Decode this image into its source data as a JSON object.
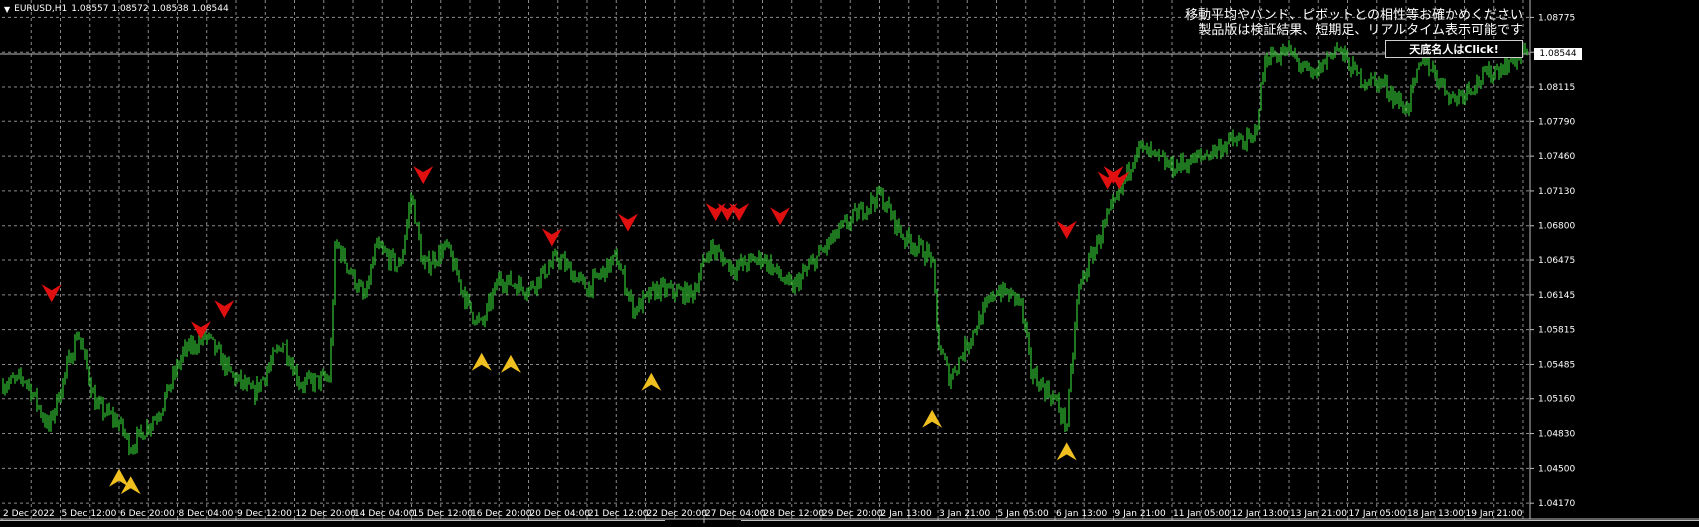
{
  "header": {
    "symbol": "EURUSD,H1",
    "ohlc": "1.08557 1.08572 1.08538 1.08544",
    "expand_icon": "triangle-down-icon"
  },
  "notice": {
    "line1": "移動平均やバンド、ピボットとの相性等お確かめください",
    "line2": "製品版は検証結果、短期足、リアルタイム表示可能です"
  },
  "promo_button": {
    "label": "天底名人はClick!"
  },
  "price_axis": {
    "current_price": "1.08544",
    "labels": [
      "1.08775",
      "1.08445",
      "1.08115",
      "1.07790",
      "1.07460",
      "1.07130",
      "1.06800",
      "1.06475",
      "1.06145",
      "1.05815",
      "1.05485",
      "1.05160",
      "1.04830",
      "1.04500",
      "1.04170"
    ]
  },
  "time_axis": {
    "labels": [
      "2 Dec 2022",
      "5 Dec 12:00",
      "6 Dec 20:00",
      "8 Dec 04:00",
      "9 Dec 12:00",
      "12 Dec 20:00",
      "14 Dec 04:00",
      "15 Dec 12:00",
      "16 Dec 20:00",
      "20 Dec 04:00",
      "21 Dec 12:00",
      "22 Dec 20:00",
      "27 Dec 04:00",
      "28 Dec 12:00",
      "29 Dec 20:00",
      "2 Jan 13:00",
      "3 Jan 21:00",
      "5 Jan 05:00",
      "6 Jan 13:00",
      "9 Jan 21:00",
      "11 Jan 05:00",
      "12 Jan 13:00",
      "13 Jan 21:00",
      "17 Jan 05:00",
      "18 Jan 13:00",
      "19 Jan 21:00"
    ]
  },
  "colors": {
    "background": "#000000",
    "grid": "#8a8a8a",
    "candle": "#2fb52f",
    "sell_arrow": "#e01010",
    "buy_arrow": "#f0c020",
    "text": "#ffffff"
  },
  "chart_data": {
    "type": "line",
    "x_labels": [
      "2 Dec 2022",
      "5 Dec 12:00",
      "6 Dec 20:00",
      "8 Dec 04:00",
      "9 Dec 12:00",
      "12 Dec 20:00",
      "14 Dec 04:00",
      "15 Dec 12:00",
      "16 Dec 20:00",
      "20 Dec 04:00",
      "21 Dec 12:00",
      "22 Dec 20:00",
      "27 Dec 04:00",
      "28 Dec 12:00",
      "29 Dec 20:00",
      "2 Jan 13:00",
      "3 Jan 21:00",
      "5 Jan 05:00",
      "6 Jan 13:00",
      "9 Jan 21:00",
      "11 Jan 05:00",
      "12 Jan 13:00",
      "13 Jan 21:00",
      "17 Jan 05:00",
      "18 Jan 13:00",
      "19 Jan 21:00"
    ],
    "ylim": [
      1.0402,
      1.0894
    ],
    "grid": true,
    "price_path": [
      [
        0,
        1.053
      ],
      [
        0.4,
        1.0535
      ],
      [
        0.8,
        1.0488
      ],
      [
        1.3,
        1.058
      ],
      [
        1.6,
        1.051
      ],
      [
        2.0,
        1.0493
      ],
      [
        2.2,
        1.047
      ],
      [
        2.7,
        1.0505
      ],
      [
        3.1,
        1.056
      ],
      [
        3.5,
        1.0575
      ],
      [
        3.9,
        1.054
      ],
      [
        4.3,
        1.052
      ],
      [
        4.8,
        1.057
      ],
      [
        5.1,
        1.053
      ],
      [
        5.6,
        1.0535
      ],
      [
        5.7,
        1.0665
      ],
      [
        6.2,
        1.061
      ],
      [
        6.4,
        1.066
      ],
      [
        6.8,
        1.064
      ],
      [
        7.0,
        1.071
      ],
      [
        7.2,
        1.064
      ],
      [
        7.6,
        1.066
      ],
      [
        8.0,
        1.06
      ],
      [
        8.2,
        1.0585
      ],
      [
        8.5,
        1.063
      ],
      [
        9.0,
        1.062
      ],
      [
        9.5,
        1.065
      ],
      [
        10.0,
        1.062
      ],
      [
        10.5,
        1.065
      ],
      [
        10.8,
        1.06
      ],
      [
        11.2,
        1.062
      ],
      [
        11.8,
        1.0615
      ],
      [
        12.1,
        1.066
      ],
      [
        12.5,
        1.064
      ],
      [
        13.0,
        1.065
      ],
      [
        13.5,
        1.062
      ],
      [
        14.0,
        1.0655
      ],
      [
        14.4,
        1.068
      ],
      [
        15.0,
        1.071
      ],
      [
        15.4,
        1.067
      ],
      [
        15.9,
        1.065
      ],
      [
        16.0,
        1.057
      ],
      [
        16.2,
        1.0535
      ],
      [
        16.6,
        1.058
      ],
      [
        17.0,
        1.062
      ],
      [
        17.4,
        1.061
      ],
      [
        17.6,
        1.054
      ],
      [
        18.0,
        1.0515
      ],
      [
        18.2,
        1.049
      ],
      [
        18.4,
        1.062
      ],
      [
        18.8,
        1.0675
      ],
      [
        19.1,
        1.071
      ],
      [
        19.4,
        1.0755
      ],
      [
        20.0,
        1.0735
      ],
      [
        20.5,
        1.0745
      ],
      [
        21.0,
        1.076
      ],
      [
        21.4,
        1.076
      ],
      [
        21.6,
        1.084
      ],
      [
        22.0,
        1.0845
      ],
      [
        22.4,
        1.082
      ],
      [
        22.8,
        1.085
      ],
      [
        23.2,
        1.082
      ],
      [
        23.6,
        1.0815
      ],
      [
        24.0,
        1.079
      ],
      [
        24.3,
        1.084
      ],
      [
        24.8,
        1.08
      ],
      [
        25.3,
        1.082
      ],
      [
        25.9,
        1.084
      ],
      [
        26.3,
        1.0854
      ]
    ],
    "sell_signals": [
      [
        0.85,
        1.0615
      ],
      [
        3.4,
        1.058
      ],
      [
        3.8,
        1.06
      ],
      [
        7.2,
        1.0727
      ],
      [
        9.4,
        1.0668
      ],
      [
        10.7,
        1.0682
      ],
      [
        12.2,
        1.0692
      ],
      [
        12.4,
        1.0692
      ],
      [
        12.6,
        1.0692
      ],
      [
        13.3,
        1.0688
      ],
      [
        18.2,
        1.0675
      ],
      [
        18.9,
        1.0722
      ],
      [
        19.0,
        1.0727
      ],
      [
        19.1,
        1.0722
      ]
    ],
    "buy_signals": [
      [
        2.0,
        1.0442
      ],
      [
        2.2,
        1.0435
      ],
      [
        8.2,
        1.0552
      ],
      [
        8.7,
        1.055
      ],
      [
        11.1,
        1.0533
      ],
      [
        15.9,
        1.0498
      ],
      [
        18.2,
        1.0467
      ]
    ]
  }
}
